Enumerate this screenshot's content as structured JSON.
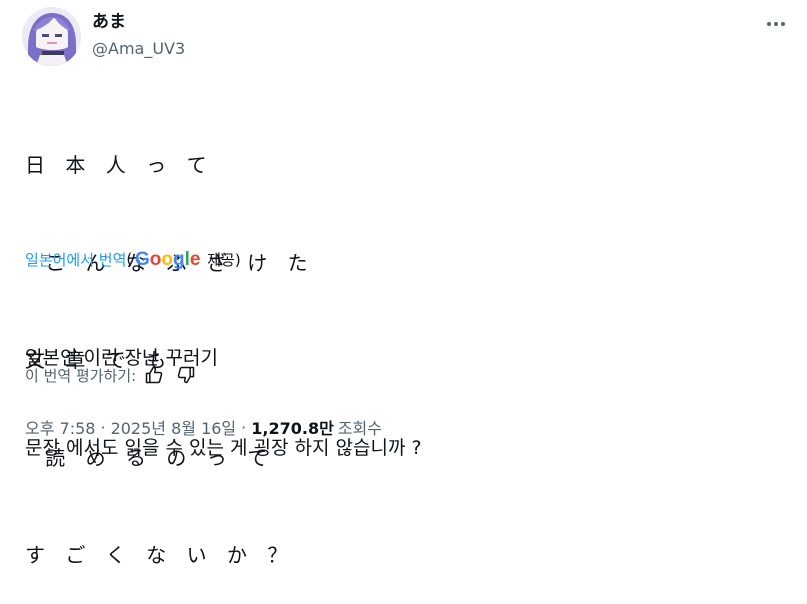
{
  "author": {
    "display_name": "あま",
    "handle": "@Ama_UV3"
  },
  "tweet": {
    "lines": [
      "日　本　人　っ　て",
      "　こ　ん　な　ふ　ざ　け　た",
      "文　章　で　も",
      "　読　め　る　の　っ　て",
      "す　ご　く　な　い　か　？"
    ]
  },
  "translation": {
    "translated_from_label": "일본어에서 번역",
    "paren_open": "(",
    "provider": "Google",
    "provided_label": "제공)",
    "lines": [
      "일본인 이런 장난 꾸러기",
      "문장 에서도 읽을 수 있는 게 굉장 하지 않습니까 ?"
    ]
  },
  "rate_translation": {
    "label": "이 번역 평가하기:"
  },
  "meta": {
    "time": "오후 7:58",
    "separator": "·",
    "date": "2025년 8월 16일",
    "views": "1,270.8만",
    "views_label": "조회수"
  },
  "icons": {
    "more": "more-horizontal-icon",
    "thumbs_up": "thumbs-up-icon",
    "thumbs_down": "thumbs-down-icon"
  },
  "colors": {
    "link": "#1d9bf0",
    "muted": "#536471",
    "text": "#0f1419"
  }
}
